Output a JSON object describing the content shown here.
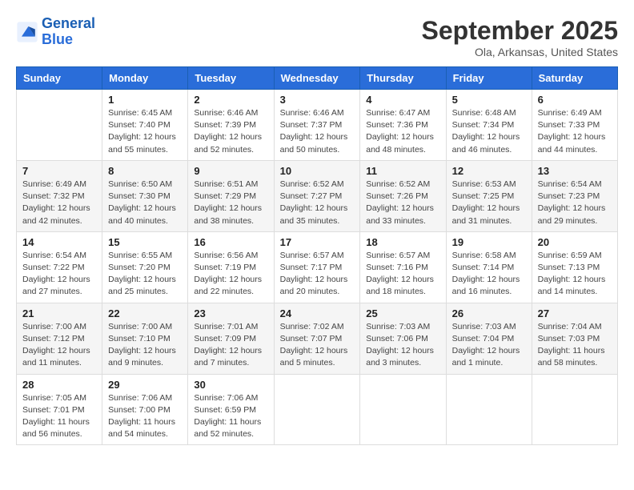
{
  "header": {
    "logo_line1": "General",
    "logo_line2": "Blue",
    "month": "September 2025",
    "location": "Ola, Arkansas, United States"
  },
  "weekdays": [
    "Sunday",
    "Monday",
    "Tuesday",
    "Wednesday",
    "Thursday",
    "Friday",
    "Saturday"
  ],
  "weeks": [
    [
      null,
      {
        "num": "1",
        "sunrise": "6:45 AM",
        "sunset": "7:40 PM",
        "daylight": "12 hours and 55 minutes."
      },
      {
        "num": "2",
        "sunrise": "6:46 AM",
        "sunset": "7:39 PM",
        "daylight": "12 hours and 52 minutes."
      },
      {
        "num": "3",
        "sunrise": "6:46 AM",
        "sunset": "7:37 PM",
        "daylight": "12 hours and 50 minutes."
      },
      {
        "num": "4",
        "sunrise": "6:47 AM",
        "sunset": "7:36 PM",
        "daylight": "12 hours and 48 minutes."
      },
      {
        "num": "5",
        "sunrise": "6:48 AM",
        "sunset": "7:34 PM",
        "daylight": "12 hours and 46 minutes."
      },
      {
        "num": "6",
        "sunrise": "6:49 AM",
        "sunset": "7:33 PM",
        "daylight": "12 hours and 44 minutes."
      }
    ],
    [
      {
        "num": "7",
        "sunrise": "6:49 AM",
        "sunset": "7:32 PM",
        "daylight": "12 hours and 42 minutes."
      },
      {
        "num": "8",
        "sunrise": "6:50 AM",
        "sunset": "7:30 PM",
        "daylight": "12 hours and 40 minutes."
      },
      {
        "num": "9",
        "sunrise": "6:51 AM",
        "sunset": "7:29 PM",
        "daylight": "12 hours and 38 minutes."
      },
      {
        "num": "10",
        "sunrise": "6:52 AM",
        "sunset": "7:27 PM",
        "daylight": "12 hours and 35 minutes."
      },
      {
        "num": "11",
        "sunrise": "6:52 AM",
        "sunset": "7:26 PM",
        "daylight": "12 hours and 33 minutes."
      },
      {
        "num": "12",
        "sunrise": "6:53 AM",
        "sunset": "7:25 PM",
        "daylight": "12 hours and 31 minutes."
      },
      {
        "num": "13",
        "sunrise": "6:54 AM",
        "sunset": "7:23 PM",
        "daylight": "12 hours and 29 minutes."
      }
    ],
    [
      {
        "num": "14",
        "sunrise": "6:54 AM",
        "sunset": "7:22 PM",
        "daylight": "12 hours and 27 minutes."
      },
      {
        "num": "15",
        "sunrise": "6:55 AM",
        "sunset": "7:20 PM",
        "daylight": "12 hours and 25 minutes."
      },
      {
        "num": "16",
        "sunrise": "6:56 AM",
        "sunset": "7:19 PM",
        "daylight": "12 hours and 22 minutes."
      },
      {
        "num": "17",
        "sunrise": "6:57 AM",
        "sunset": "7:17 PM",
        "daylight": "12 hours and 20 minutes."
      },
      {
        "num": "18",
        "sunrise": "6:57 AM",
        "sunset": "7:16 PM",
        "daylight": "12 hours and 18 minutes."
      },
      {
        "num": "19",
        "sunrise": "6:58 AM",
        "sunset": "7:14 PM",
        "daylight": "12 hours and 16 minutes."
      },
      {
        "num": "20",
        "sunrise": "6:59 AM",
        "sunset": "7:13 PM",
        "daylight": "12 hours and 14 minutes."
      }
    ],
    [
      {
        "num": "21",
        "sunrise": "7:00 AM",
        "sunset": "7:12 PM",
        "daylight": "12 hours and 11 minutes."
      },
      {
        "num": "22",
        "sunrise": "7:00 AM",
        "sunset": "7:10 PM",
        "daylight": "12 hours and 9 minutes."
      },
      {
        "num": "23",
        "sunrise": "7:01 AM",
        "sunset": "7:09 PM",
        "daylight": "12 hours and 7 minutes."
      },
      {
        "num": "24",
        "sunrise": "7:02 AM",
        "sunset": "7:07 PM",
        "daylight": "12 hours and 5 minutes."
      },
      {
        "num": "25",
        "sunrise": "7:03 AM",
        "sunset": "7:06 PM",
        "daylight": "12 hours and 3 minutes."
      },
      {
        "num": "26",
        "sunrise": "7:03 AM",
        "sunset": "7:04 PM",
        "daylight": "12 hours and 1 minute."
      },
      {
        "num": "27",
        "sunrise": "7:04 AM",
        "sunset": "7:03 PM",
        "daylight": "11 hours and 58 minutes."
      }
    ],
    [
      {
        "num": "28",
        "sunrise": "7:05 AM",
        "sunset": "7:01 PM",
        "daylight": "11 hours and 56 minutes."
      },
      {
        "num": "29",
        "sunrise": "7:06 AM",
        "sunset": "7:00 PM",
        "daylight": "11 hours and 54 minutes."
      },
      {
        "num": "30",
        "sunrise": "7:06 AM",
        "sunset": "6:59 PM",
        "daylight": "11 hours and 52 minutes."
      },
      null,
      null,
      null,
      null
    ]
  ]
}
